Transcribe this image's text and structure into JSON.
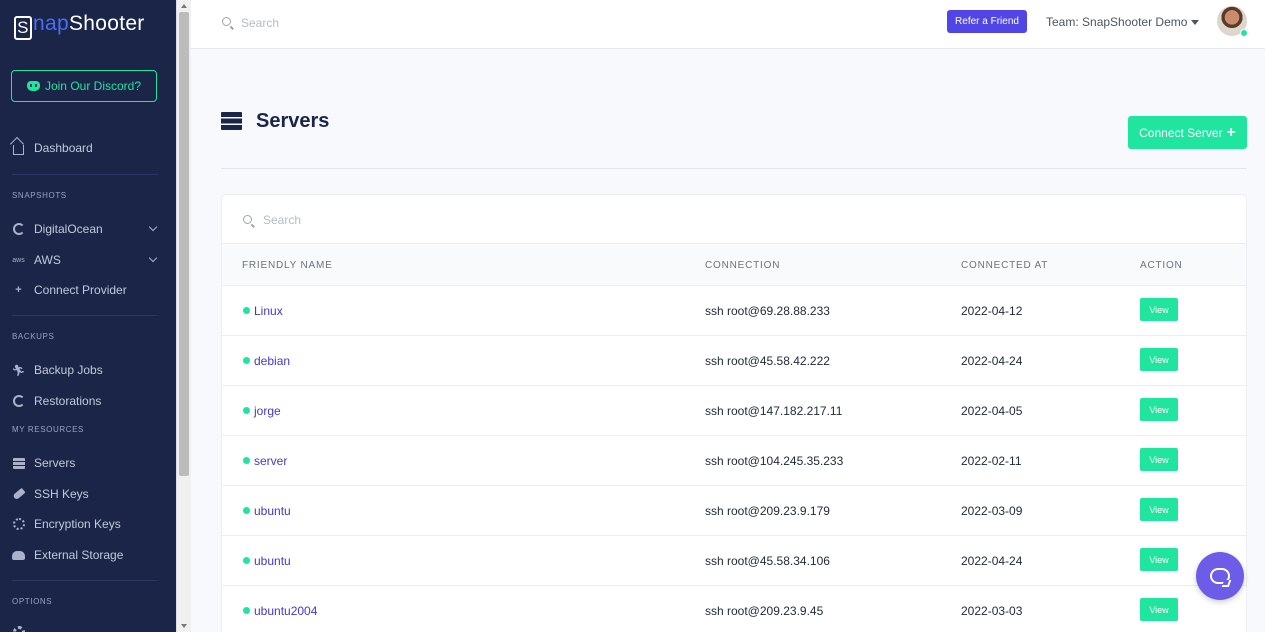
{
  "brand": {
    "logo_first": "S",
    "logo_snap": "nap",
    "logo_rest": "Shooter"
  },
  "sidebar": {
    "discord_label": "Join Our Discord?",
    "dashboard": "Dashboard",
    "sections": {
      "snapshots": "SNAPSHOTS",
      "backups": "BACKUPS",
      "resources": "MY RESOURCES",
      "options": "OPTIONS"
    },
    "items": {
      "digitalocean": "DigitalOcean",
      "aws": "AWS",
      "connect_provider": "Connect Provider",
      "backup_jobs": "Backup Jobs",
      "restorations": "Restorations",
      "servers": "Servers",
      "ssh_keys": "SSH Keys",
      "encryption_keys": "Encryption Keys",
      "external_storage": "External Storage"
    },
    "aws_icon_text": "aws"
  },
  "topbar": {
    "search_placeholder": "Search",
    "refer_label": "Refer a Friend",
    "team_label": "Team: SnapShooter Demo"
  },
  "page": {
    "title": "Servers",
    "connect_label": "Connect Server",
    "table_search_placeholder": "Search",
    "columns": [
      "FRIENDLY NAME",
      "CONNECTION",
      "CONNECTED AT",
      "ACTION"
    ],
    "rows": [
      {
        "name": "Linux",
        "connection": "ssh root@69.28.88.233",
        "date": "2022-04-12",
        "action": "View"
      },
      {
        "name": "debian",
        "connection": "ssh root@45.58.42.222",
        "date": "2022-04-24",
        "action": "View"
      },
      {
        "name": "jorge",
        "connection": "ssh root@147.182.217.11",
        "date": "2022-04-05",
        "action": "View"
      },
      {
        "name": "server",
        "connection": "ssh root@104.245.35.233",
        "date": "2022-02-11",
        "action": "View"
      },
      {
        "name": "ubuntu",
        "connection": "ssh root@209.23.9.179",
        "date": "2022-03-09",
        "action": "View"
      },
      {
        "name": "ubuntu",
        "connection": "ssh root@45.58.34.106",
        "date": "2022-04-24",
        "action": "View"
      },
      {
        "name": "ubuntu2004",
        "connection": "ssh root@209.23.9.45",
        "date": "2022-03-03",
        "action": "View"
      }
    ]
  },
  "colors": {
    "sidebar_bg": "#1b2547",
    "accent_green": "#1fe59f",
    "accent_purple": "#4f46e5",
    "link": "#4338ca"
  }
}
